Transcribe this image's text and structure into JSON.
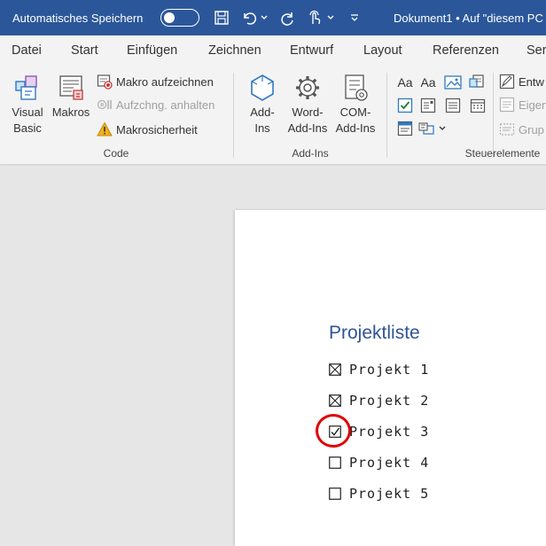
{
  "titlebar": {
    "autosave_label": "Automatisches Speichern",
    "autosave_state": "off",
    "document_title": "Dokument1 • Auf \"diesem PC",
    "quick_access": [
      "save-icon",
      "undo-icon",
      "redo-icon",
      "touch-mode-icon",
      "customize-icon"
    ]
  },
  "tabs": [
    {
      "label": "Datei"
    },
    {
      "label": "Start"
    },
    {
      "label": "Einfügen"
    },
    {
      "label": "Zeichnen"
    },
    {
      "label": "Entwurf"
    },
    {
      "label": "Layout"
    },
    {
      "label": "Referenzen"
    },
    {
      "label": "Ser"
    }
  ],
  "ribbon": {
    "code": {
      "group_label": "Code",
      "visual_basic": [
        "Visual",
        "Basic"
      ],
      "macros": "Makros",
      "record_macro": "Makro aufzeichnen",
      "pause_recording": "Aufzchng. anhalten",
      "macro_security": "Makrosicherheit"
    },
    "addins": {
      "group_label": "Add-Ins",
      "addins": [
        "Add-",
        "Ins"
      ],
      "word_addins": [
        "Word-",
        "Add-Ins"
      ],
      "com_addins": [
        "COM-",
        "Add-Ins"
      ]
    },
    "controls": {
      "group_label": "Steuerelemente",
      "design_mode": "Entw",
      "properties": "Eigen",
      "group": "Grup"
    }
  },
  "document": {
    "title": "Projektliste",
    "items": [
      {
        "label": "Projekt 1",
        "state": "crossed"
      },
      {
        "label": "Projekt 2",
        "state": "crossed"
      },
      {
        "label": "Projekt 3",
        "state": "checked"
      },
      {
        "label": "Projekt 4",
        "state": "empty"
      },
      {
        "label": "Projekt 5",
        "state": "empty"
      }
    ]
  },
  "colors": {
    "titlebar": "#2b579a",
    "heading": "#2f5496",
    "highlight": "#e00000"
  }
}
